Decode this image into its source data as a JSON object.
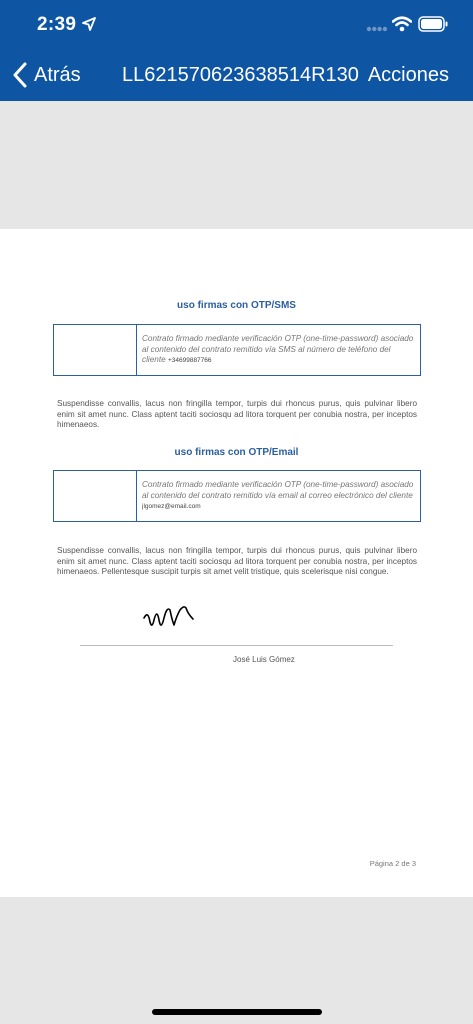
{
  "status_bar": {
    "time": "2:39"
  },
  "nav": {
    "back_label": "Atrás",
    "title": "LL621570623638514R130",
    "actions_label": "Acciones"
  },
  "document": {
    "sms_section": {
      "title": "uso firmas con OTP/SMS",
      "box_text": "Contrato firmado mediante verificación OTP (one-time-password) asociado al contenido del contrato remitido vía SMS al número de teléfono del cliente",
      "contact": "+34699887766"
    },
    "paragraph_1": "Suspendisse convallis, lacus non fringilla tempor, turpis dui rhoncus purus, quis pulvinar libero enim sit amet nunc. Class aptent taciti sociosqu ad litora torquent per conubia nostra, per inceptos himenaeos.",
    "email_section": {
      "title": "uso firmas con OTP/Email",
      "box_text": "Contrato firmado mediante verificación OTP (one-time-password) asociado al contenido del contrato remitido vía email al correo electrónico del cliente",
      "contact": "jlgomez@email.com"
    },
    "paragraph_2": "Suspendisse convallis, lacus non fringilla tempor, turpis dui rhoncus purus, quis pulvinar libero enim sit amet nunc. Class aptent taciti sociosqu ad litora torquent per conubia nostra, per inceptos himenaeos. Pellentesque suscipit turpis sit amet velit tristique, quis scelerisque nisi congue.",
    "signer_name": "José Luis Gómez",
    "page_number": "Página 2 de 3"
  },
  "colors": {
    "nav_background": "#0e55a3",
    "accent": "#2c5f9e",
    "viewer_background": "#e6e6e6"
  },
  "icons": [
    "location-arrow-icon",
    "cellular-signal-icon",
    "wifi-icon",
    "battery-icon",
    "chevron-left-icon"
  ]
}
